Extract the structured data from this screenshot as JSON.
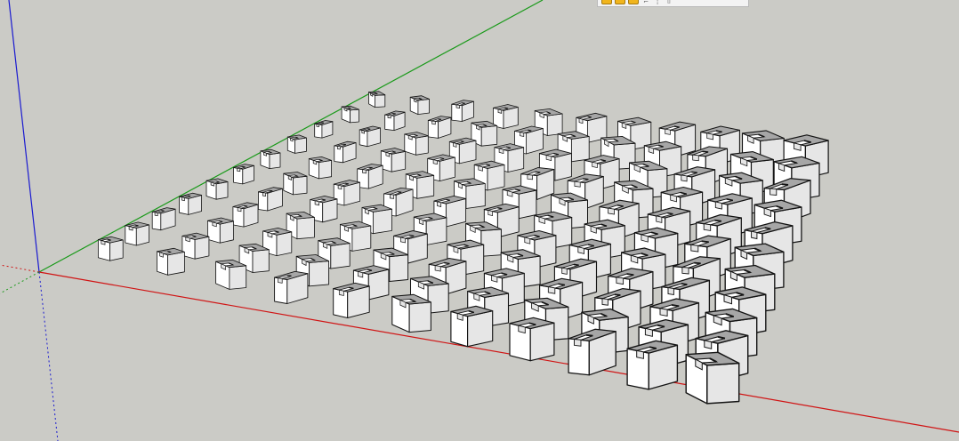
{
  "app": {
    "window_type": "3D modeling viewport"
  },
  "colors": {
    "background": "#cbcbc6",
    "red_axis": "#d01414",
    "green_axis": "#1a9a1a",
    "blue_axis": "#1a1ad0",
    "cube_top": "#a6a6a6",
    "cube_left": "#ffffff",
    "cube_right": "#e6e6e6",
    "edge": "#141414",
    "toolbar_button": "#f1b51c"
  },
  "toolbar": {
    "buttons": [
      {
        "icon": "tool-icon-1"
      },
      {
        "icon": "tool-icon-2"
      },
      {
        "icon": "tool-icon-3"
      }
    ],
    "glyphs": [
      {
        "icon": "tool-glyph-1"
      },
      {
        "icon": "tool-glyph-2"
      },
      {
        "icon": "tool-glyph-3"
      }
    ]
  },
  "scene": {
    "object_type": "notched cube",
    "grid_rows": 11,
    "grid_cols": 11
  }
}
